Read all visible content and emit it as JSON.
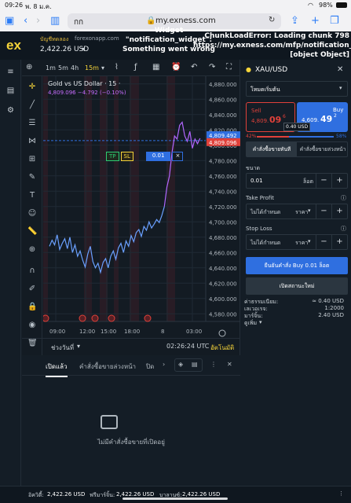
{
  "status": {
    "time": "09:26",
    "date": "พ. 8 ม.ค.",
    "battery": "98%"
  },
  "safari": {
    "tab_count": "กก",
    "url": "my.exness.com"
  },
  "header": {
    "logo": "ex",
    "account_type": "บัญชีทดลอง",
    "site": "forexonapp.com",
    "balance": "2,422.26 USD"
  },
  "errors": {
    "widget": "Widget \"notification_widget\": Something went wrong",
    "chunk": "ChunkLoadError: Loading chunk 798 https://my.exness.com/mfp/notification_widget [object Object]"
  },
  "chart": {
    "timeframes": [
      "1m",
      "5m",
      "4h",
      "15m"
    ],
    "active_timeframe": "15m",
    "title": "Gold vs US Dollar · 15 ·",
    "quote": "4,809.096  −4.792 (−0.10%)",
    "order_line": {
      "tp": "TP",
      "sl": "SL",
      "volume": "0.01",
      "close": "×"
    },
    "range_label": "ช่วงวันที่",
    "clock": "02:26:24 UTC",
    "auto_label": "อัตโนมัติ"
  },
  "chart_data": {
    "type": "line",
    "title": "Gold vs US Dollar · 15 ·",
    "xlabel": "",
    "ylabel": "",
    "x_ticks": [
      "09:00",
      "12:00",
      "15:00",
      "18:00",
      "8",
      "03:00"
    ],
    "y_ticks": [
      4880,
      4860,
      4840,
      4820,
      4800,
      4780,
      4760,
      4740,
      4720,
      4700,
      4680,
      4660,
      4640,
      4620,
      4600,
      4580
    ],
    "y_tick_labels": [
      "4,880.000",
      "4,860.000",
      "4,840.000",
      "4,820.000",
      "4,800.000",
      "4,780.000",
      "4,760.000",
      "4,740.000",
      "4,720.000",
      "4,700.000",
      "4,680.000",
      "4,660.000",
      "4,640.000",
      "4,620.000",
      "4,600.000",
      "4,580.000"
    ],
    "ylim": [
      4570,
      4890
    ],
    "price_labels": {
      "ask": "4,809.492",
      "bid": "4,809.096"
    },
    "series": [
      {
        "color": "#6aa0ff",
        "x": [
          0,
          3,
          6,
          9,
          12,
          15,
          18,
          21,
          24,
          27,
          30,
          33,
          36,
          39,
          42,
          45,
          48,
          51,
          54,
          57,
          60,
          63,
          66,
          69,
          72,
          75,
          78,
          81,
          84,
          87,
          90,
          93,
          96,
          99,
          102,
          105,
          108,
          111,
          114,
          117,
          120,
          123,
          126,
          129,
          132,
          135
        ],
        "y": [
          4668,
          4676,
          4670,
          4683,
          4664,
          4672,
          4678,
          4665,
          4680,
          4660,
          4670,
          4655,
          4662,
          4650,
          4641,
          4658,
          4668,
          4648,
          4640,
          4646,
          4634,
          4647,
          4652,
          4640,
          4655,
          4662,
          4651,
          4666,
          4672,
          4660,
          4675,
          4668,
          4682,
          4674,
          4686,
          4690,
          4681,
          4694,
          4689,
          4700,
          4692,
          4697,
          4703,
          4699,
          4708,
          4720
        ]
      },
      {
        "color": "#b266ff",
        "x": [
          135,
          138,
          141,
          144,
          147,
          150,
          153,
          156,
          159,
          162,
          165,
          168,
          171,
          174,
          177
        ],
        "y": [
          4720,
          4745,
          4760,
          4790,
          4812,
          4808,
          4826,
          4830,
          4812,
          4805,
          4818,
          4796,
          4808,
          4802,
          4809
        ]
      }
    ],
    "grid": true
  },
  "orders": {
    "tabs": [
      "เปิดแล้ว",
      "คำสั่งซื้อขายล่วงหน้า",
      "ปิด"
    ],
    "empty_text": "ไม่มีคำสั่งซื้อขายที่เปิดอยู่"
  },
  "order_panel": {
    "symbol": "XAU/USD",
    "mode": "โหมดเริ่มต้น",
    "sell_label": "Sell",
    "sell_price_main": "4,809.",
    "sell_price_big": "09",
    "sell_price_sup": "6",
    "buy_label": "Buy",
    "buy_price_main": "4,609.",
    "buy_price_big": "49",
    "buy_price_sup": "2",
    "spread": "0.40 USD",
    "sell_pct": "42%",
    "buy_pct": "58%",
    "type_market": "คำสั่งซื้อขายทันที",
    "type_pending": "คำสั่งซื้อขายล่วงหน้า",
    "volume_label": "ขนาด",
    "volume_value": "0.01",
    "volume_unit": "ล็อต",
    "tp_label": "Take Profit",
    "tp_value": "ไม่ได้กำหนด",
    "tp_unit": "ราคา",
    "sl_label": "Stop Loss",
    "sl_value": "ไม่ได้กำหนด",
    "sl_unit": "ราคา",
    "confirm_button": "ยืนยันคำสั่ง Buy 0.01 ล็อต",
    "margin_button": "เปิดสถานะใหม่",
    "info": [
      {
        "k": "ค่าธรรมเนียม:",
        "v": "≈ 0.40 USD"
      },
      {
        "k": "เลเวอเรจ:",
        "v": "1:2000"
      },
      {
        "k": "มาร์จิ้น:",
        "v": "2.40 USD"
      }
    ],
    "more_label": "ดูเพิ่ม"
  },
  "footer": {
    "equity_label": "อิควิตี้:",
    "equity": "2,422.26 USD",
    "free_margin_label": "ฟรีมาร์จิ้น:",
    "free_margin": "2,422.26 USD",
    "balance_label": "บาลานซ์:",
    "balance": "2,422.26 USD"
  }
}
